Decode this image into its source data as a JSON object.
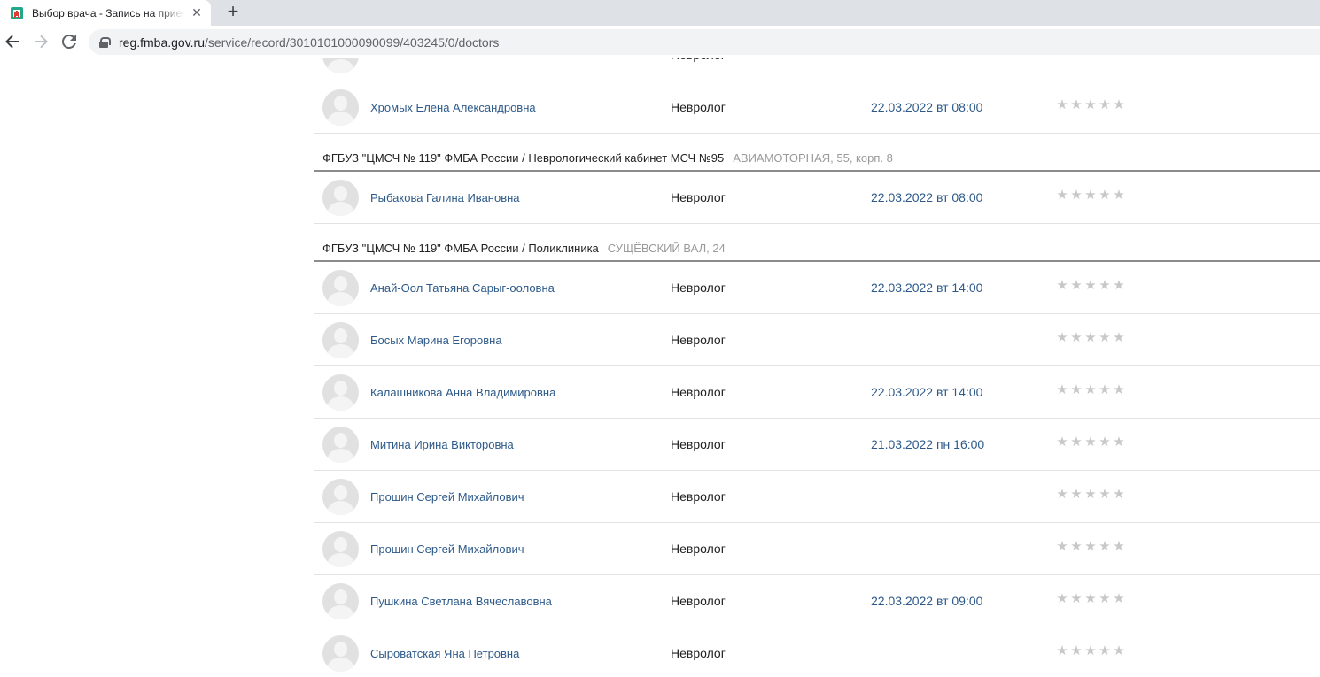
{
  "browser": {
    "tab_title": "Выбор врача - Запись на прием к врачу",
    "tab_close": "✕",
    "new_tab": "+",
    "url_host": "reg.fmba.gov.ru",
    "url_path": "/service/record/3010101000090099/403245/0/doctors"
  },
  "icons": {
    "back": "arrow-left-icon",
    "forward": "arrow-right-icon",
    "reload": "reload-icon",
    "lock": "lock-icon",
    "star": "★"
  },
  "colors": {
    "link": "#2d5a8a",
    "star_inactive": "#c8c8c8",
    "address_muted": "#9a9a9a"
  },
  "groups": [
    {
      "title": "",
      "address": "",
      "doctors": [
        {
          "name": "",
          "specialty": "Невролог",
          "date": "",
          "rating": 0
        },
        {
          "name": "Хромых Елена Александровна",
          "specialty": "Невролог",
          "date": "22.03.2022 вт 08:00",
          "rating": 0
        }
      ]
    },
    {
      "title": "ФГБУЗ \"ЦМСЧ № 119\" ФМБА России / Неврологический кабинет МСЧ №95",
      "address": "АВИАМОТОРНАЯ, 55, корп. 8",
      "doctors": [
        {
          "name": "Рыбакова Галина Ивановна",
          "specialty": "Невролог",
          "date": "22.03.2022 вт 08:00",
          "rating": 0
        }
      ]
    },
    {
      "title": "ФГБУЗ \"ЦМСЧ № 119\" ФМБА России / Поликлиника",
      "address": "СУЩЁВСКИЙ ВАЛ, 24",
      "doctors": [
        {
          "name": "Анай-Оол Татьяна Сарыг-ооловна",
          "specialty": "Невролог",
          "date": "22.03.2022 вт 14:00",
          "rating": 0
        },
        {
          "name": "Босых Марина Егоровна",
          "specialty": "Невролог",
          "date": "",
          "rating": 0
        },
        {
          "name": "Калашникова Анна Владимировна",
          "specialty": "Невролог",
          "date": "22.03.2022 вт 14:00",
          "rating": 0
        },
        {
          "name": "Митина Ирина Викторовна",
          "specialty": "Невролог",
          "date": "21.03.2022 пн 16:00",
          "rating": 0
        },
        {
          "name": "Прошин Сергей Михайлович",
          "specialty": "Невролог",
          "date": "",
          "rating": 0
        },
        {
          "name": "Прошин Сергей Михайлович",
          "specialty": "Невролог",
          "date": "",
          "rating": 0
        },
        {
          "name": "Пушкина Светлана Вячеславовна",
          "specialty": "Невролог",
          "date": "22.03.2022 вт 09:00",
          "rating": 0
        },
        {
          "name": "Сыроватская Яна Петровна",
          "specialty": "Невролог",
          "date": "",
          "rating": 0
        }
      ]
    }
  ]
}
